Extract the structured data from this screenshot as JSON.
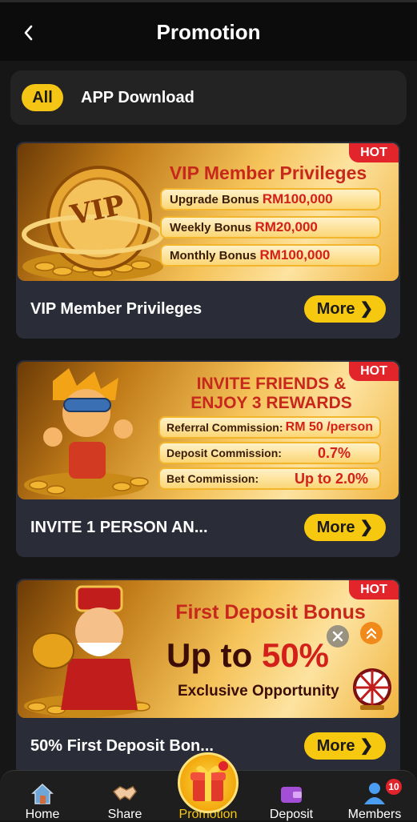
{
  "header": {
    "title": "Promotion"
  },
  "tabs": [
    {
      "label": "All",
      "active": true
    },
    {
      "label": "APP Download",
      "active": false
    }
  ],
  "cards": [
    {
      "title": "VIP Member Privileges",
      "more_label": "More",
      "banner": {
        "hot": "HOT",
        "logo_text": "VIP",
        "heading": "VIP Member Privileges",
        "rows": [
          {
            "label": "Upgrade Bonus",
            "value": "RM100,000"
          },
          {
            "label": "Weekly Bonus",
            "value": "RM20,000"
          },
          {
            "label": "Monthly Bonus",
            "value": "RM100,000"
          }
        ]
      }
    },
    {
      "title": "INVITE 1 PERSON AN...",
      "more_label": "More",
      "banner": {
        "hot": "HOT",
        "heading_1": "INVITE FRIENDS &",
        "heading_2": "ENJOY 3 REWARDS",
        "rows": [
          {
            "label": "Referral Commission:",
            "value": "RM 50 /person"
          },
          {
            "label": "Deposit Commission:",
            "value": "0.7%"
          },
          {
            "label": "Bet Commission:",
            "value": "Up to 2.0%"
          }
        ]
      }
    },
    {
      "title": "50% First Deposit Bon...",
      "more_label": "More",
      "banner": {
        "hot": "HOT",
        "heading": "First Deposit Bonus",
        "big_prefix": "Up to ",
        "big_value": "50%",
        "sub": "Exclusive Opportunity"
      }
    }
  ],
  "nav": [
    {
      "label": "Home",
      "icon": "home-icon"
    },
    {
      "label": "Share",
      "icon": "handshake-icon"
    },
    {
      "label": "Promotion",
      "icon": "gift-icon"
    },
    {
      "label": "Deposit",
      "icon": "wallet-icon"
    },
    {
      "label": "Members",
      "icon": "user-icon",
      "badge": "10"
    }
  ],
  "colors": {
    "accent": "#f6c80f",
    "hot": "#e2242b",
    "card_bg": "#2a2d38",
    "page_bg": "#161616"
  }
}
